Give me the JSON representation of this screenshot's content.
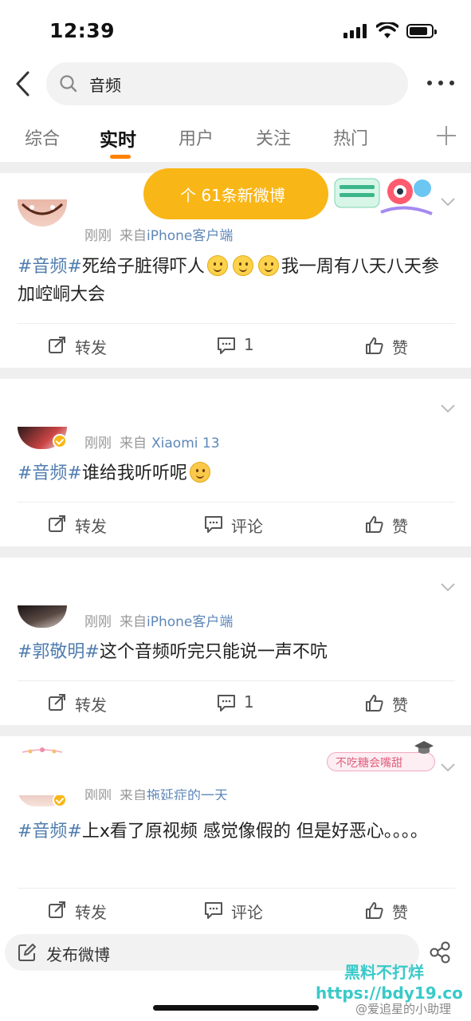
{
  "status_bar": {
    "time": "12:39"
  },
  "search": {
    "query": "音频"
  },
  "tabs": [
    {
      "label": "综合"
    },
    {
      "label": "实时"
    },
    {
      "label": "用户"
    },
    {
      "label": "关注"
    },
    {
      "label": "热门"
    }
  ],
  "new_posts_banner": "个 61条新微博",
  "action_labels": {
    "repost": "转发",
    "comment": "评论",
    "like": "赞"
  },
  "posts": [
    {
      "time": "刚刚",
      "source_prefix": "来自",
      "source": "iPhone客户端",
      "hashtag": "#音频#",
      "text_a": "死给子脏得吓人",
      "text_b": "我一周有八天八天参加崆峒大会",
      "comment_count": "1"
    },
    {
      "time": "刚刚",
      "source_prefix": "来自",
      "source": "Xiaomi 13",
      "hashtag": "#音频#",
      "text_a": "谁给我听听呢",
      "comment_label": "评论"
    },
    {
      "time": "刚刚",
      "source_prefix": "来自",
      "source": "iPhone客户端",
      "hashtag": "#郭敬明#",
      "text_a": "这个音频听完只能说一声不吭",
      "comment_count": "1"
    },
    {
      "time": "刚刚",
      "source_prefix": "来自",
      "source": "拖延症的一天",
      "hashtag": "#音频#",
      "text_a": "上x看了原视频 感觉像假的 但是好恶心。。。。",
      "badge_text": "不吃糖会嘴甜",
      "comment_label": "评论"
    }
  ],
  "compose": {
    "label": "发布微博"
  },
  "watermark": {
    "line1": "黑料不打烊",
    "line2": "https://bdy19.co"
  },
  "credit": "@爱追星的小助理",
  "colors": {
    "accent": "#ff8200",
    "pill": "#f9b617",
    "link": "#507daf"
  }
}
